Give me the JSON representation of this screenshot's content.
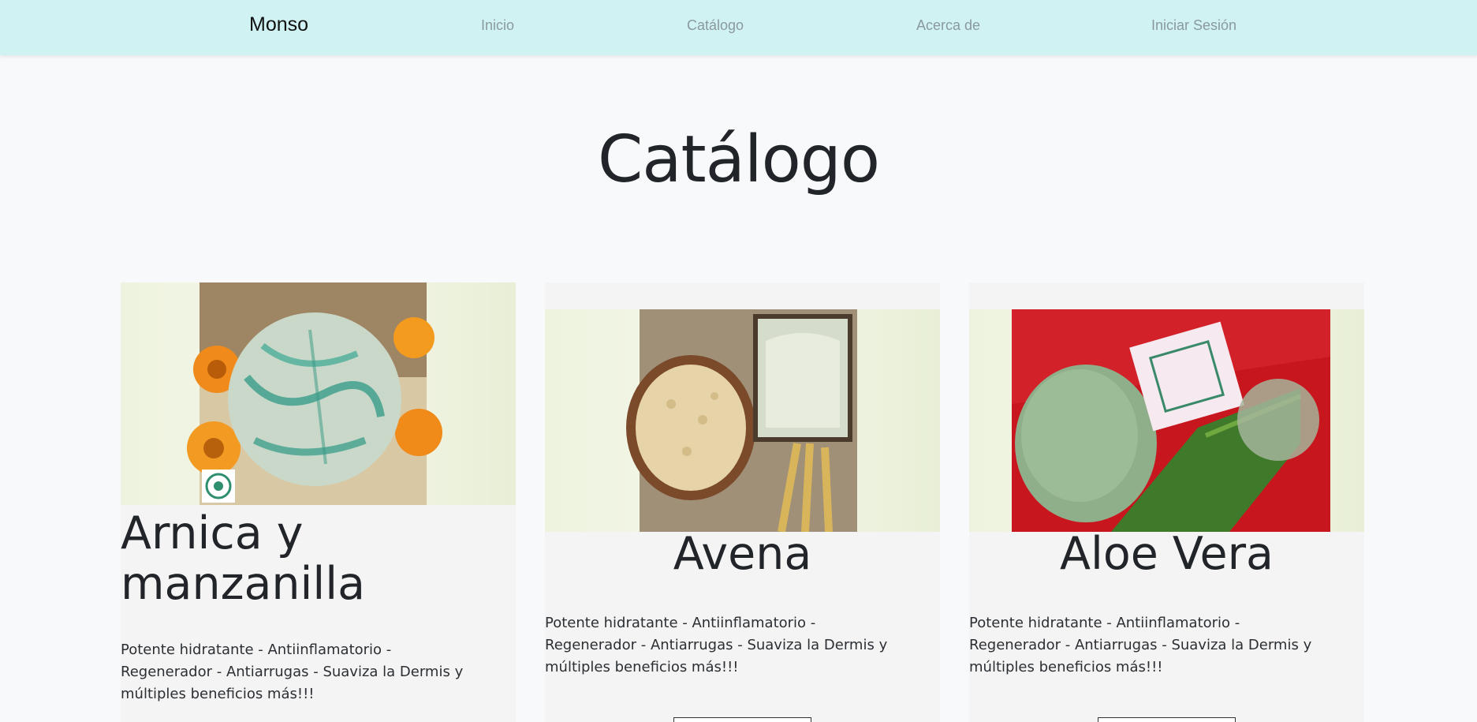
{
  "navbar": {
    "brand": "Monso",
    "links": [
      "Inicio",
      "Catálogo",
      "Acerca de",
      "Iniciar Sesión"
    ]
  },
  "page": {
    "title": "Catálogo"
  },
  "products": [
    {
      "name": "Arnica y manzanilla",
      "description": "Potente hidratante - Antiinflamatorio - Regenerador - Antiarrugas - Suaviza la Dermis y múltiples beneficios más!!!",
      "image_icon": "round-green-soap-with-flowers-image"
    },
    {
      "name": "Avena",
      "description": "Potente hidratante - Antiinflamatorio - Regenerador - Antiarrugas - Suaviza la Dermis y múltiples beneficios más!!!",
      "image_icon": "oat-soap-image"
    },
    {
      "name": "Aloe Vera",
      "description": "Potente hidratante - Antiinflamatorio - Regenerador - Antiarrugas - Suaviza la Dermis y múltiples beneficios más!!!",
      "image_icon": "aloe-vera-soap-image"
    }
  ],
  "colors": {
    "navbar_bg": "#d1f2f2",
    "page_bg": "#f8f9fb",
    "card_bg": "#f4f4f4"
  }
}
